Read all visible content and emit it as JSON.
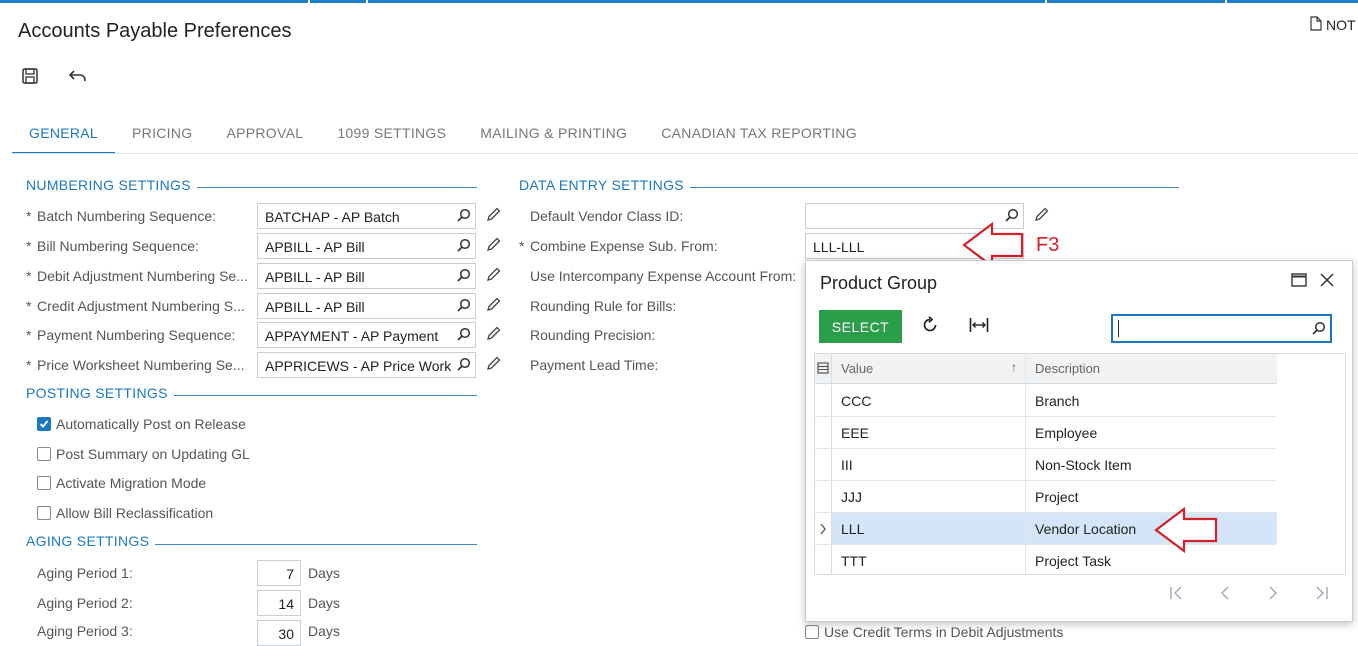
{
  "header": {
    "title": "Accounts Payable Preferences",
    "notes_label": "NOT"
  },
  "tabs": [
    {
      "label": "GENERAL"
    },
    {
      "label": "PRICING"
    },
    {
      "label": "APPROVAL"
    },
    {
      "label": "1099 SETTINGS"
    },
    {
      "label": "MAILING & PRINTING"
    },
    {
      "label": "CANADIAN TAX REPORTING"
    }
  ],
  "numbering": {
    "title": "NUMBERING SETTINGS",
    "rows": [
      {
        "label": "Batch Numbering Sequence:",
        "value": "BATCHAP - AP Batch"
      },
      {
        "label": "Bill Numbering Sequence:",
        "value": "APBILL - AP Bill"
      },
      {
        "label": "Debit Adjustment Numbering Se...",
        "value": "APBILL - AP Bill"
      },
      {
        "label": "Credit Adjustment Numbering S...",
        "value": "APBILL - AP Bill"
      },
      {
        "label": "Payment Numbering Sequence:",
        "value": "APPAYMENT - AP Payment"
      },
      {
        "label": "Price Worksheet Numbering Se...",
        "value": "APPRICEWS - AP Price Work"
      }
    ]
  },
  "posting": {
    "title": "POSTING SETTINGS",
    "options": [
      {
        "label": "Automatically Post on Release",
        "checked": true
      },
      {
        "label": "Post Summary on Updating GL",
        "checked": false
      },
      {
        "label": "Activate Migration Mode",
        "checked": false
      },
      {
        "label": "Allow Bill Reclassification",
        "checked": false
      }
    ]
  },
  "aging": {
    "title": "AGING SETTINGS",
    "rows": [
      {
        "label": "Aging Period 1:",
        "value": "7",
        "unit": "Days"
      },
      {
        "label": "Aging Period 2:",
        "value": "14",
        "unit": "Days"
      },
      {
        "label": "Aging Period 3:",
        "value": "30",
        "unit": "Days"
      }
    ]
  },
  "data_entry": {
    "title": "DATA ENTRY SETTINGS",
    "default_vendor_class_label": "Default Vendor Class ID:",
    "default_vendor_class_value": "",
    "combine_expense_label": "Combine Expense Sub. From:",
    "combine_expense_value": "LLL-LLL",
    "intercompany_label": "Use Intercompany Expense Account From:",
    "rounding_rule_label": "Rounding Rule for Bills:",
    "rounding_precision_label": "Rounding Precision:",
    "payment_lead_label": "Payment Lead Time:",
    "credit_terms_label": "Use Credit Terms in Debit Adjustments"
  },
  "annotation": {
    "f3_label": "F3",
    "color": "#d42027"
  },
  "popup": {
    "title": "Product Group",
    "select_label": "SELECT",
    "search_value": "",
    "columns": {
      "value": "Value",
      "description": "Description"
    },
    "rows": [
      {
        "value": "CCC",
        "description": "Branch"
      },
      {
        "value": "EEE",
        "description": "Employee"
      },
      {
        "value": "III",
        "description": "Non-Stock Item"
      },
      {
        "value": "JJJ",
        "description": "Project"
      },
      {
        "value": "LLL",
        "description": "Vendor Location",
        "selected": true
      },
      {
        "value": "TTT",
        "description": "Project Task"
      }
    ]
  },
  "colors": {
    "accent": "#1a78c2",
    "select_button": "#2b9e4a",
    "selected_row": "#d3e5f6"
  }
}
